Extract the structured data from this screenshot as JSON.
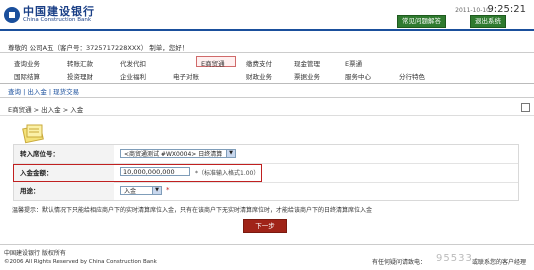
{
  "header": {
    "bank_name_cn": "中国建设银行",
    "bank_name_en": "China Construction Bank",
    "date": "2011-10-10",
    "time": "9:25:21",
    "faq_button": "常见问题解答",
    "logout_button": "退出系统"
  },
  "welcome": "尊敬的 公司A五（客户号：3725717228XXX） 制单，您好！",
  "menu": {
    "row1": [
      "查询业务",
      "转账汇款",
      "代发代扣",
      "E商贸通",
      "缴费支付",
      "现金管理",
      "E票通"
    ],
    "row2": [
      "国际结算",
      "投资理财",
      "企业福利",
      "电子对账",
      "财政业务",
      "票据业务",
      "服务中心",
      "分行特色"
    ],
    "selected": "E商贸通"
  },
  "subnav": "查询 | 出入金 | 现货交易",
  "breadcrumb": "E商贸通 > 出入金 > 入金",
  "form": {
    "row1_label": "转入席位号：",
    "row1_value": "<商贸通测试 #WX0004> 日终清算",
    "row2_label": "入金金额：",
    "row2_value": "10,000,000,000",
    "row2_hint": "*（标准输入格式1.00）",
    "row3_label": "用途：",
    "row3_value": "入金",
    "row3_required": "*"
  },
  "tip": "温馨提示：默认情况下只能给相应商户下的实时清算席位入金，只有在该商户下无实时清算席位时，才能给该商户下的日终清算席位入金",
  "next_button": "下一步",
  "footer": {
    "logo_text": "中国建设银行 版权所有",
    "copyright": "©2006 All Rights Reserved by China Construction Bank",
    "support": "有任何疑问请致电：",
    "counter": "95533",
    "service": "或联系您的客户经理"
  },
  "colors": {
    "brand_blue": "#1a4f9c",
    "highlight_red": "#c02020",
    "button_red": "#a02418"
  }
}
